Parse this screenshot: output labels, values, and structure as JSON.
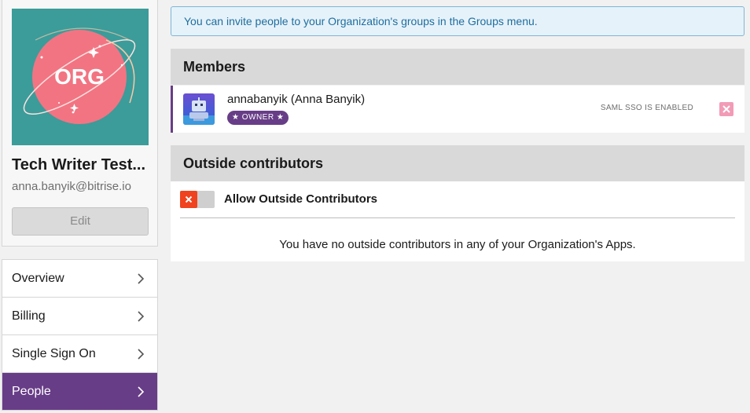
{
  "org": {
    "logo_text": "ORG",
    "name": "Tech Writer Test...",
    "email": "anna.banyik@bitrise.io",
    "edit_label": "Edit"
  },
  "nav": {
    "items": [
      {
        "label": "Overview",
        "active": false
      },
      {
        "label": "Billing",
        "active": false
      },
      {
        "label": "Single Sign On",
        "active": false
      },
      {
        "label": "People",
        "active": true
      }
    ]
  },
  "banner": {
    "text": "You can invite people to your Organization's groups in the Groups menu."
  },
  "members": {
    "title": "Members",
    "rows": [
      {
        "name": "annabanyik (Anna Banyik)",
        "role": "★ OWNER ★",
        "status": "SAML SSO IS ENABLED",
        "remove_icon": "close-icon"
      }
    ]
  },
  "outside_contributors": {
    "title": "Outside contributors",
    "toggle_label": "Allow Outside Contributors",
    "toggle_state": "off",
    "empty_message": "You have no outside contributors in any of your Organization's Apps."
  },
  "colors": {
    "brand_purple": "#683d87",
    "logo_bg": "#3b9c9a",
    "logo_circle": "#f27482",
    "toggle_off": "#f0421e",
    "banner_text": "#1e6e9e"
  }
}
